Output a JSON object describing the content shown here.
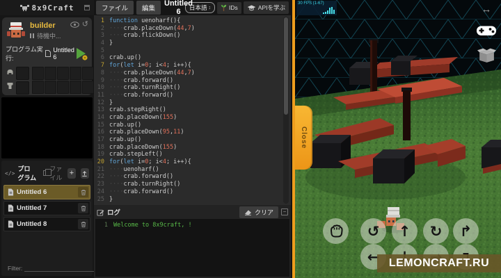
{
  "app": {
    "logo_text": "8x9Craft",
    "accent_orange": "#ee9d1d"
  },
  "sidebar": {
    "character": {
      "name": "builder",
      "status": "待機中...",
      "run_label": "プログラム実行:",
      "run_target": "Untitled 6"
    },
    "programs": {
      "program_tab": "プログラム",
      "file_tab": "ファイル",
      "add_button": "+",
      "items": [
        {
          "name": "Untitled 6",
          "selected": true
        },
        {
          "name": "Untitled 7",
          "selected": false
        },
        {
          "name": "Untitled 8",
          "selected": false
        }
      ],
      "filter_label": "Filter:",
      "filter_clear": "×"
    }
  },
  "menubar": {
    "file_menu": "ファイル",
    "edit_menu": "編集",
    "doc_title": "Untitled 6",
    "language_select": "日本語",
    "language_select_arrow": "↕",
    "ids_button": "IDs",
    "learn_api_button": "APIを学ぶ"
  },
  "editor": {
    "colors": {
      "keyword": "#61a5d8",
      "number": "#e0705a",
      "plain": "#cfcfcf",
      "gutter": "#5d5d5d",
      "gutter_fold": "#bfa032",
      "background": "#2b2b2b"
    },
    "lines": [
      {
        "n": 1,
        "fold": true,
        "tokens": [
          [
            "kw",
            "function"
          ],
          [
            "pl",
            " uenoharf(){"
          ]
        ]
      },
      {
        "n": 2,
        "tokens": [
          [
            "ws",
            "····"
          ],
          [
            "pl",
            "crab.placeDown("
          ],
          [
            "num",
            "44"
          ],
          [
            "pl",
            ","
          ],
          [
            "num",
            "7"
          ],
          [
            "pl",
            ")"
          ]
        ]
      },
      {
        "n": 3,
        "tokens": [
          [
            "ws",
            "····"
          ],
          [
            "pl",
            "crab.flickDown()"
          ]
        ]
      },
      {
        "n": 4,
        "tokens": [
          [
            "pl",
            "}"
          ]
        ]
      },
      {
        "n": 5,
        "tokens": []
      },
      {
        "n": 6,
        "tokens": [
          [
            "pl",
            "crab.up()"
          ]
        ]
      },
      {
        "n": 7,
        "fold": true,
        "tokens": [
          [
            "kw",
            "for"
          ],
          [
            "pl",
            "("
          ],
          [
            "kw",
            "let"
          ],
          [
            "pl",
            " i="
          ],
          [
            "num",
            "0"
          ],
          [
            "pl",
            "; i<"
          ],
          [
            "num",
            "4"
          ],
          [
            "pl",
            "; i++){"
          ]
        ]
      },
      {
        "n": 8,
        "tokens": [
          [
            "ws",
            "····"
          ],
          [
            "pl",
            "crab.placeDown("
          ],
          [
            "num",
            "44"
          ],
          [
            "pl",
            ","
          ],
          [
            "num",
            "7"
          ],
          [
            "pl",
            ")"
          ]
        ]
      },
      {
        "n": 9,
        "tokens": [
          [
            "ws",
            "····"
          ],
          [
            "pl",
            "crab.forward()"
          ]
        ]
      },
      {
        "n": 10,
        "tokens": [
          [
            "ws",
            "····"
          ],
          [
            "pl",
            "crab.turnRight()"
          ]
        ]
      },
      {
        "n": 11,
        "tokens": [
          [
            "ws",
            "····"
          ],
          [
            "pl",
            "crab.forward()"
          ]
        ]
      },
      {
        "n": 12,
        "tokens": [
          [
            "pl",
            "}"
          ]
        ]
      },
      {
        "n": 13,
        "tokens": [
          [
            "pl",
            "crab.stepRight()"
          ]
        ]
      },
      {
        "n": 14,
        "tokens": [
          [
            "pl",
            "crab.placeDown("
          ],
          [
            "num",
            "155"
          ],
          [
            "pl",
            ")"
          ]
        ]
      },
      {
        "n": 15,
        "tokens": [
          [
            "pl",
            "crab.up()"
          ]
        ]
      },
      {
        "n": 16,
        "tokens": [
          [
            "pl",
            "crab.placeDown("
          ],
          [
            "num",
            "95"
          ],
          [
            "pl",
            ","
          ],
          [
            "num",
            "11"
          ],
          [
            "pl",
            ")"
          ]
        ]
      },
      {
        "n": 17,
        "tokens": [
          [
            "pl",
            "crab.up()"
          ]
        ]
      },
      {
        "n": 18,
        "tokens": [
          [
            "pl",
            "crab.placeDown("
          ],
          [
            "num",
            "155"
          ],
          [
            "pl",
            ")"
          ]
        ]
      },
      {
        "n": 19,
        "tokens": [
          [
            "pl",
            "crab.stepLeft()"
          ]
        ]
      },
      {
        "n": 20,
        "fold": true,
        "tokens": [
          [
            "kw",
            "for"
          ],
          [
            "pl",
            "("
          ],
          [
            "kw",
            "let"
          ],
          [
            "pl",
            " i="
          ],
          [
            "num",
            "0"
          ],
          [
            "pl",
            "; i<"
          ],
          [
            "num",
            "4"
          ],
          [
            "pl",
            "; i++){"
          ]
        ]
      },
      {
        "n": 21,
        "tokens": [
          [
            "ws",
            "····"
          ],
          [
            "pl",
            "uenoharf()"
          ]
        ]
      },
      {
        "n": 22,
        "tokens": [
          [
            "ws",
            "····"
          ],
          [
            "pl",
            "crab.forward()"
          ]
        ]
      },
      {
        "n": 23,
        "tokens": [
          [
            "ws",
            "····"
          ],
          [
            "pl",
            "crab.turnRight()"
          ]
        ]
      },
      {
        "n": 24,
        "tokens": [
          [
            "ws",
            "····"
          ],
          [
            "pl",
            "crab.forward()"
          ]
        ]
      },
      {
        "n": 25,
        "tokens": [
          [
            "pl",
            "}"
          ]
        ]
      }
    ]
  },
  "log": {
    "title": "ログ",
    "clear_button": "クリア",
    "entries": [
      {
        "n": 1,
        "text": "Welcome to 8x9craft, !"
      }
    ]
  },
  "game": {
    "fps_label": "30 FPS (1-67)",
    "close_tab": "Close",
    "watermark": "LEMONCRAFT.RU",
    "controls": [
      {
        "name": "grab-hand-button",
        "glyph": "hand"
      },
      {
        "name": "rotate-left-button",
        "glyph": "↺"
      },
      {
        "name": "move-up-button",
        "glyph": "↑"
      },
      {
        "name": "rotate-right-button",
        "glyph": "↻"
      },
      {
        "name": "turn-up-button",
        "glyph": "↱"
      },
      {
        "name": "move-left-button",
        "glyph": "←"
      },
      {
        "name": "move-down-button",
        "glyph": "↓"
      },
      {
        "name": "move-right-button",
        "glyph": "→"
      },
      {
        "name": "turn-down-button",
        "glyph": "↴"
      }
    ]
  }
}
